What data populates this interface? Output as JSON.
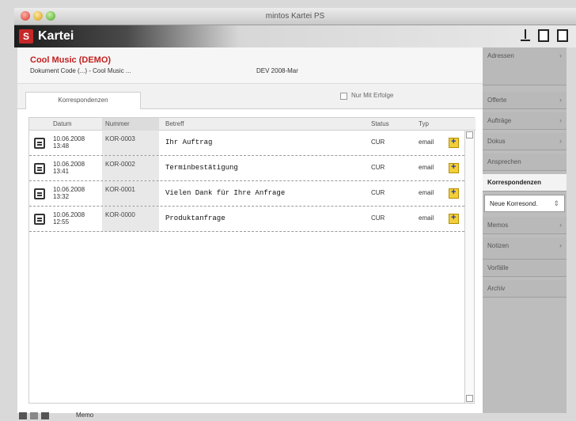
{
  "window": {
    "title": "mintos Kartei PS"
  },
  "app": {
    "logo_text": "S",
    "title": "Kartei"
  },
  "header": {
    "customer": "Cool Music (DEMO)",
    "contact": "Dokument Code (...)  -  Cool Music ...",
    "date": "DEV 2008-Mar"
  },
  "tabs": {
    "active": "Korrespondenzen"
  },
  "search": {
    "label": "Nur Mit Erfolge"
  },
  "table": {
    "headers": {
      "date": "Datum",
      "number": "Nummer",
      "subject": "Betreff",
      "status": "Status",
      "type": "Typ"
    },
    "rows": [
      {
        "date": "10.06.2008\n13:48",
        "number": "KOR-0003",
        "subject": "Ihr Auftrag",
        "status": "CUR",
        "type": "email"
      },
      {
        "date": "10.06.2008\n13:41",
        "number": "KOR-0002",
        "subject": "Terminbestätigung",
        "status": "CUR",
        "type": "email"
      },
      {
        "date": "10.06.2008\n13:32",
        "number": "KOR-0001",
        "subject": "Vielen Dank für Ihre Anfrage",
        "status": "CUR",
        "type": "email"
      },
      {
        "date": "10.06.2008\n12:55",
        "number": "KOR-0000",
        "subject": "Produktanfrage",
        "status": "CUR",
        "type": "email"
      }
    ]
  },
  "sidebar": {
    "items": [
      {
        "label": "Adressen"
      },
      {
        "label": "Offerte"
      },
      {
        "label": "Aufträge"
      },
      {
        "label": "Dokus"
      },
      {
        "label": "Ansprechen"
      },
      {
        "label": "Korrespondenzen",
        "active": true
      },
      {
        "label": "Neue Korresond."
      },
      {
        "label": "Memos"
      },
      {
        "label": "Notizen"
      },
      {
        "label": "Vorfälle"
      },
      {
        "label": "Archiv"
      }
    ]
  },
  "statusbar": {
    "text": "Memo"
  }
}
